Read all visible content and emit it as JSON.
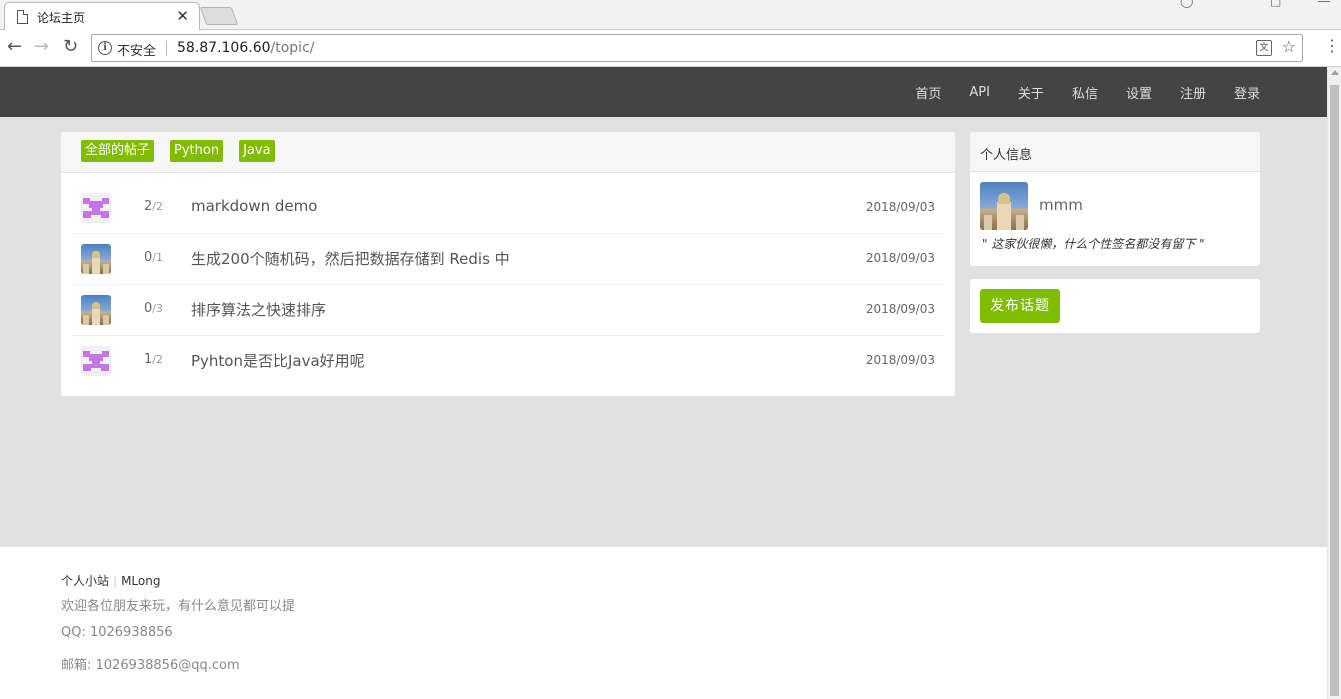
{
  "browser": {
    "tab_title": "论坛主页",
    "close_glyph": "✕",
    "security_label": "不安全",
    "url_host": "58.87.106.60",
    "url_path": "/topic/",
    "icons": [
      "page-icon",
      "tab-close-icon",
      "new-tab-icon",
      "back-icon",
      "forward-icon",
      "reload-icon",
      "info-icon",
      "translate-icon",
      "star-icon",
      "menu-icon"
    ]
  },
  "navbar": {
    "items": [
      "首页",
      "API",
      "关于",
      "私信",
      "设置",
      "注册",
      "登录"
    ]
  },
  "tabs": [
    "全部的帖子",
    "Python",
    "Java"
  ],
  "topics": [
    {
      "replies": "2",
      "visits": "2",
      "title": "markdown demo",
      "date": "2018/09/03",
      "avatar": "identicon"
    },
    {
      "replies": "0",
      "visits": "1",
      "title": "生成200个随机码，然后把数据存储到 Redis 中",
      "date": "2018/09/03",
      "avatar": "photo"
    },
    {
      "replies": "0",
      "visits": "3",
      "title": "排序算法之快速排序",
      "date": "2018/09/03",
      "avatar": "photo"
    },
    {
      "replies": "1",
      "visits": "2",
      "title": "Pyhton是否比Java好用呢",
      "date": "2018/09/03",
      "avatar": "identicon"
    }
  ],
  "sidebar": {
    "header": "个人信息",
    "username": "mmm",
    "signature": "\" 这家伙很懒，什么个性签名都没有留下 \"",
    "post_button": "发布话题"
  },
  "footer": {
    "link1": "个人小站",
    "link2": "MLong",
    "welcome": "欢迎各位朋友来玩，有什么意见都可以提",
    "qq": "QQ: 1026938856",
    "email": "邮箱: 1026938856@qq.com"
  },
  "colors": {
    "accent": "#80bd01",
    "navbar_bg": "#444444",
    "content_bg": "#e1e1e1",
    "identicon": "#c675e6"
  }
}
